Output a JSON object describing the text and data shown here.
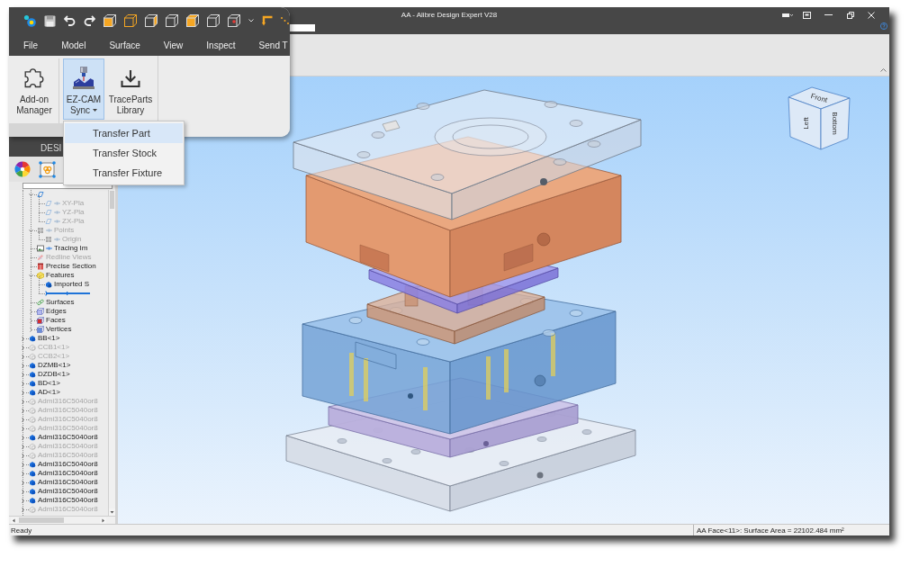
{
  "window": {
    "title": "AA - Alibre Design Expert V28"
  },
  "menu": {
    "tabs": [
      "File",
      "Model",
      "Surface",
      "View",
      "Inspect",
      "Send T"
    ]
  },
  "ribbon": {
    "buttons": [
      {
        "kind": "puzzle",
        "label": "Add-on Manager",
        "open": false,
        "dropdown": false
      },
      {
        "kind": "mill",
        "label": "EZ-CAM Sync",
        "open": true,
        "dropdown": true
      },
      {
        "kind": "download",
        "label": "TraceParts Library",
        "open": false,
        "dropdown": false
      }
    ]
  },
  "dropdown_menu": {
    "items": [
      {
        "label": "Transfer Part",
        "selected": true
      },
      {
        "label": "Transfer Stock",
        "selected": false
      },
      {
        "label": "Transfer Fixture",
        "selected": false
      }
    ]
  },
  "explorer": {
    "title": "DESI"
  },
  "tree": {
    "items": [
      {
        "children": [
          {
            "kind": "planes",
            "expanded": true,
            "children": [
              {
                "kind": "plane",
                "label": "XY-Pla",
                "dimmed": true
              },
              {
                "kind": "plane",
                "label": "YZ-Pla",
                "dimmed": true
              },
              {
                "kind": "plane",
                "label": "ZX-Pla",
                "dimmed": true
              }
            ]
          },
          {
            "kind": "points",
            "label": "Points",
            "dimmed": true,
            "expanded": true,
            "children": [
              {
                "kind": "point",
                "label": "Origin",
                "dimmed": true
              }
            ]
          },
          {
            "kind": "image",
            "label": "Tracing Im",
            "dimmed": false
          },
          {
            "kind": "redline",
            "label": "Redline Views",
            "dimmed": true
          },
          {
            "kind": "section",
            "label": "Precise Section",
            "dimmed": false
          },
          {
            "kind": "features",
            "label": "Features",
            "dimmed": false,
            "expanded": true,
            "children": [
              {
                "kind": "solid",
                "label": "Imported S",
                "dimmed": false
              },
              {
                "kind": "rollback"
              }
            ]
          },
          {
            "kind": "surfaces",
            "label": "Surfaces",
            "dimmed": false
          },
          {
            "kind": "edges",
            "label": "Edges",
            "dimmed": false,
            "expanded": false
          },
          {
            "kind": "faces",
            "label": "Faces",
            "dimmed": false,
            "expanded": false
          },
          {
            "kind": "vertices",
            "label": "Vertices",
            "dimmed": false,
            "expanded": false
          }
        ]
      },
      {
        "kind": "part",
        "label": "BB<1>",
        "dimmed": false,
        "expanded": false
      },
      {
        "kind": "part",
        "label": "CCB1<1>",
        "dimmed": true,
        "expanded": false
      },
      {
        "kind": "part",
        "label": "CCB2<1>",
        "dimmed": true,
        "expanded": false
      },
      {
        "kind": "part",
        "label": "DZMB<1>",
        "dimmed": false,
        "expanded": false
      },
      {
        "kind": "part",
        "label": "DZDB<1>",
        "dimmed": false,
        "expanded": false
      },
      {
        "kind": "part",
        "label": "BD<1>",
        "dimmed": false,
        "expanded": false
      },
      {
        "kind": "part",
        "label": "AD<1>",
        "dimmed": false,
        "expanded": false
      },
      {
        "kind": "part",
        "label": "Admi316C5040or8",
        "dimmed": true,
        "expanded": false
      },
      {
        "kind": "part",
        "label": "Admi316C5040or8",
        "dimmed": true,
        "expanded": false
      },
      {
        "kind": "part",
        "label": "Admi316C5040or8",
        "dimmed": true,
        "expanded": false
      },
      {
        "kind": "part",
        "label": "Admi316C5040or8",
        "dimmed": true,
        "expanded": false
      },
      {
        "kind": "part",
        "label": "Admi316C5040or8",
        "dimmed": false,
        "expanded": false
      },
      {
        "kind": "part",
        "label": "Admi316C5040or8",
        "dimmed": true,
        "expanded": false
      },
      {
        "kind": "part",
        "label": "Admi316C5040or8",
        "dimmed": true,
        "expanded": false
      },
      {
        "kind": "part",
        "label": "Admi316C5040or8",
        "dimmed": false,
        "expanded": false
      },
      {
        "kind": "part",
        "label": "Admi316C5040or8",
        "dimmed": false,
        "expanded": false
      },
      {
        "kind": "part",
        "label": "Admi316C5040or8",
        "dimmed": false,
        "expanded": false
      },
      {
        "kind": "part",
        "label": "Admi316C5040or8",
        "dimmed": false,
        "expanded": false
      },
      {
        "kind": "part",
        "label": "Admi316C5040or8",
        "dimmed": false,
        "expanded": false
      },
      {
        "kind": "part",
        "label": "Admi316C5040or8",
        "dimmed": true,
        "expanded": false
      }
    ]
  },
  "view_cube": {
    "faces": [
      {
        "kind": "top",
        "label": "Front"
      },
      {
        "kind": "left",
        "label": "Left"
      },
      {
        "kind": "right",
        "label": "Bottom"
      }
    ]
  },
  "status_bar": {
    "left": "Ready",
    "right": "AA Face<11>: Surface Area = 22102.484 mm²"
  }
}
